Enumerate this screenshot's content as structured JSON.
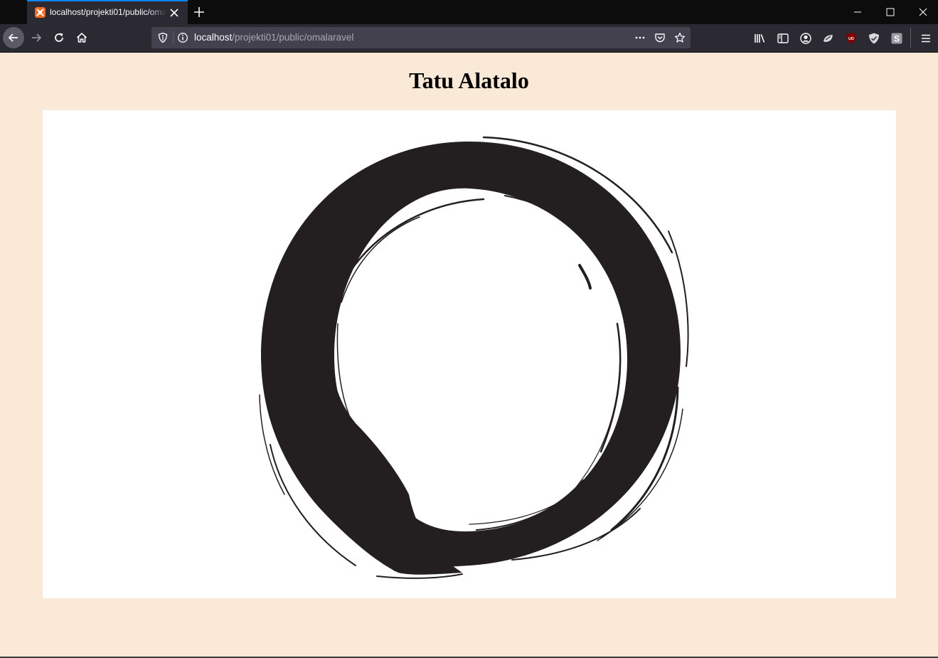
{
  "browser": {
    "tab": {
      "title": "localhost/projekti01/public/omalaravel",
      "favicon": "xampp-icon"
    },
    "url": {
      "host": "localhost",
      "path": "/projekti01/public/omalaravel"
    },
    "colors": {
      "accent": "#0a84ff",
      "chrome": "#2b2a33",
      "titlebar": "#0c0c0d"
    }
  },
  "page": {
    "heading": "Tatu Alatalo",
    "background": "#f9e9d6",
    "image": {
      "description_icon": "enso-brush-circle",
      "ink_color": "#231f20"
    }
  }
}
